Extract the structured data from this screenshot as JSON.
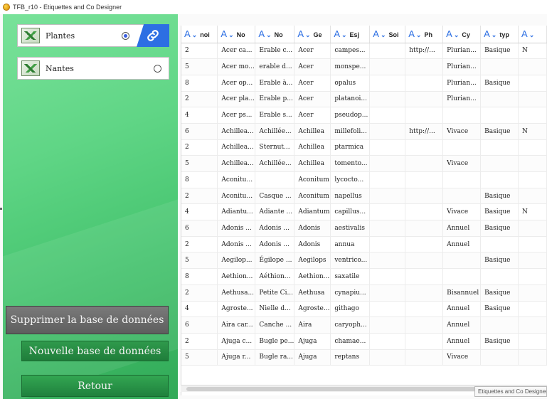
{
  "window": {
    "title": "TFB_r10 - Etiquettes and Co Designer"
  },
  "databases": [
    {
      "label": "Plantes",
      "selected": true
    },
    {
      "label": "Nantes",
      "selected": false
    }
  ],
  "buttons": {
    "delete": "Supprimer la base de données",
    "new": "Nouvelle base de données",
    "back": "Retour"
  },
  "table": {
    "headers": [
      "noi",
      "No",
      "No",
      "Ge",
      "Esj",
      "Soi",
      "Ph",
      "Cy",
      "typ",
      ""
    ],
    "rows": [
      [
        "2",
        "Acer ca...",
        "Erable c...",
        "Acer",
        "campes...",
        "",
        "http://...",
        "Plurian...",
        "Basique",
        "N"
      ],
      [
        "5",
        "Acer mo...",
        "erable d...",
        "Acer",
        "monspe...",
        "",
        "",
        "Plurian...",
        "",
        ""
      ],
      [
        "8",
        "Acer op...",
        "Erable à...",
        "Acer",
        "opalus",
        "",
        "",
        "Plurian...",
        "Basique",
        ""
      ],
      [
        "2",
        "Acer pla...",
        "Erable p...",
        "Acer",
        "platanoi...",
        "",
        "",
        "Plurian...",
        "",
        ""
      ],
      [
        "4",
        "Acer ps...",
        "Erable s...",
        "Acer",
        "pseudop...",
        "",
        "",
        "",
        "",
        ""
      ],
      [
        "6",
        "Achillea...",
        "Achillée...",
        "Achillea",
        "millefoli...",
        "",
        "http://...",
        "Vivace",
        "Basique",
        "N"
      ],
      [
        "2",
        "Achillea...",
        "Sternut...",
        "Achillea",
        "ptarmica",
        "",
        "",
        "",
        "",
        ""
      ],
      [
        "5",
        "Achillea...",
        "Achillée...",
        "Achillea",
        "tomento...",
        "",
        "",
        "Vivace",
        "",
        ""
      ],
      [
        "8",
        "Aconitu...",
        "",
        "Aconitum",
        "lycocto...",
        "",
        "",
        "",
        "",
        ""
      ],
      [
        "2",
        "Aconitu...",
        "Casque ...",
        "Aconitum",
        "napellus",
        "",
        "",
        "",
        "Basique",
        ""
      ],
      [
        "4",
        "Adiantu...",
        "Adiante ...",
        "Adiantum",
        "capillus...",
        "",
        "",
        "Vivace",
        "Basique",
        "N"
      ],
      [
        "6",
        "Adonis ...",
        "Adonis ...",
        "Adonis",
        "aestivalis",
        "",
        "",
        "Annuel",
        "Basique",
        ""
      ],
      [
        "2",
        "Adonis ...",
        "Adonis ...",
        "Adonis",
        "annua",
        "",
        "",
        "Annuel",
        "",
        ""
      ],
      [
        "5",
        "Aegilop...",
        "Égilope ...",
        "Aegilops",
        "ventrico...",
        "",
        "",
        "",
        "Basique",
        ""
      ],
      [
        "8",
        "Aethion...",
        "Aéthion...",
        "Aethion...",
        "saxatile",
        "",
        "",
        "",
        "",
        ""
      ],
      [
        "2",
        "Aethusa...",
        "Petite Ci...",
        "Aethusa",
        "cynapiu...",
        "",
        "",
        "Bisannuel",
        "Basique",
        ""
      ],
      [
        "4",
        "Agroste...",
        "Nielle d...",
        "Agroste...",
        "githago",
        "",
        "",
        "Annuel",
        "Basique",
        ""
      ],
      [
        "6",
        "Aira car...",
        "Canche ...",
        "Aira",
        "caryoph...",
        "",
        "",
        "Annuel",
        "",
        ""
      ],
      [
        "2",
        "Ajuga c...",
        "Bugle pe...",
        "Ajuga",
        "chamae...",
        "",
        "",
        "Annuel",
        "Basique",
        ""
      ],
      [
        "5",
        "Ajuga r...",
        "Bugle ra...",
        "Ajuga",
        "reptans",
        "",
        "",
        "Vivace",
        "",
        ""
      ]
    ]
  },
  "tooltip": "Etiquettes and Co Designer",
  "colors": {
    "accent": "#2d6fe3",
    "panel_green": "#5fd585",
    "button_gray": "#5e5e5e"
  }
}
